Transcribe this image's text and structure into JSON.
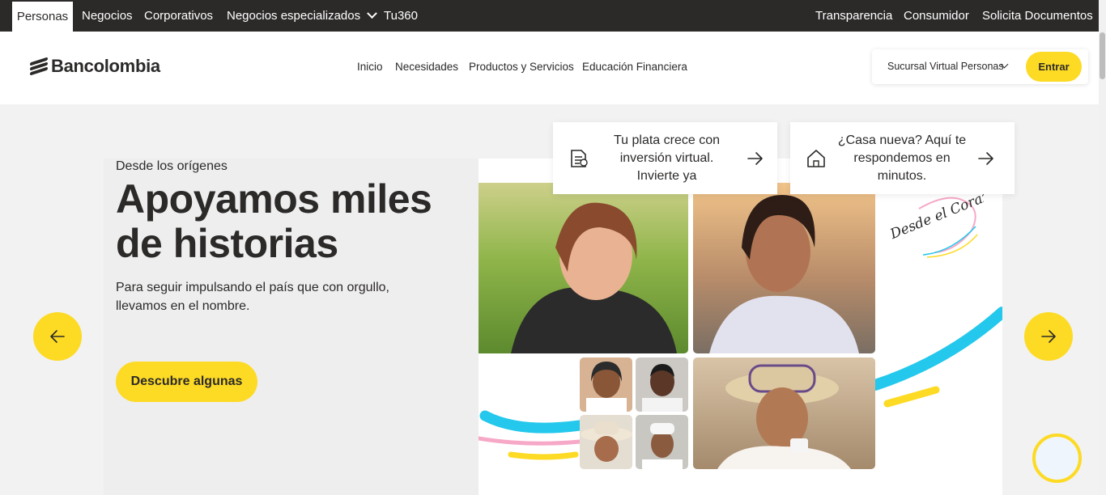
{
  "topbar": {
    "segments": [
      "Personas",
      "Negocios",
      "Corporativos",
      "Negocios especializados",
      "Tu360"
    ],
    "right_links": [
      "Transparencia",
      "Consumidor",
      "Solicita Documentos"
    ]
  },
  "header": {
    "logo_text": "Bancolombia",
    "nav": [
      "Inicio",
      "Necesidades",
      "Productos y Servicios",
      "Educación Financiera"
    ],
    "account_selector": "Sucursal Virtual Personas",
    "login_button": "Entrar"
  },
  "hero": {
    "eyebrow": "Desde los orígenes",
    "headline": "Apoyamos miles de historias",
    "subtext": "Para seguir impulsando el país que con orgullo, llevamos en el nombre.",
    "cta": "Descubre algunas",
    "signature": "Desde el Corazón"
  },
  "promos": [
    {
      "text": "Tu plata crece con inversión virtual. Invierte ya",
      "icon": "document-chart-icon"
    },
    {
      "text": "¿Casa nueva? Aquí te respondemos en minutos.",
      "icon": "house-icon"
    }
  ],
  "colors": {
    "brand_yellow": "#fdda24",
    "dark": "#2c2a29",
    "accent_cyan": "#23c8ec",
    "accent_pink": "#f6a8c6"
  }
}
